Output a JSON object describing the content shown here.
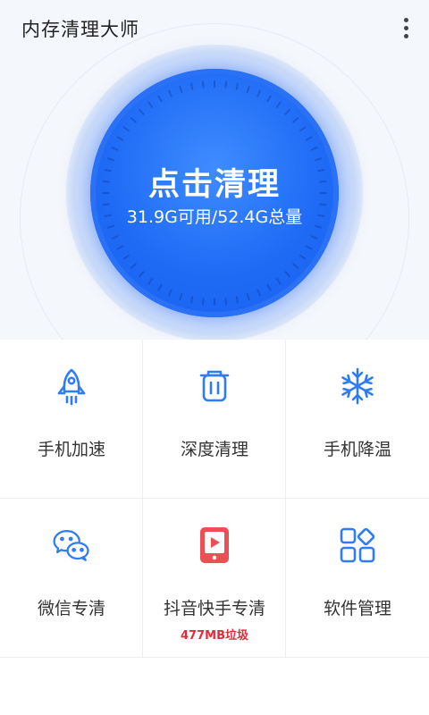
{
  "app": {
    "title": "内存清理大师",
    "more_icon": "more-vertical-icon"
  },
  "cleaner": {
    "action_label": "点击清理",
    "memory_status": "31.9G可用/52.4G总量",
    "accent_color": "#1f6bf5"
  },
  "tools": [
    {
      "label": "手机加速",
      "icon": "rocket-icon"
    },
    {
      "label": "深度清理",
      "icon": "trash-icon"
    },
    {
      "label": "手机降温",
      "icon": "snowflake-icon"
    },
    {
      "label": "微信专清",
      "icon": "wechat-icon"
    },
    {
      "label": "抖音快手专清",
      "icon": "video-play-icon",
      "badge": "477MB垃圾",
      "badge_color": "#e02b3c"
    },
    {
      "label": "软件管理",
      "icon": "apps-grid-icon"
    }
  ]
}
